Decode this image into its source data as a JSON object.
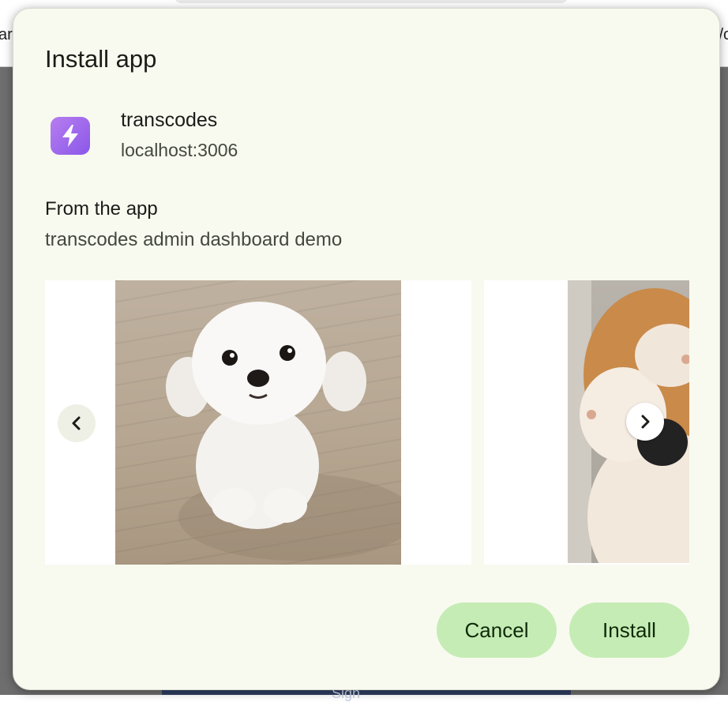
{
  "background": {
    "left_fragment": "ar",
    "right_fragment": "/c",
    "bottom_fragment": "Sign"
  },
  "dialog": {
    "title": "Install app",
    "app": {
      "name": "transcodes",
      "origin": "localhost:3006",
      "icon": "lightning-bolt-icon",
      "icon_color": "#9b6cf0"
    },
    "from_heading": "From the app",
    "description": "transcodes admin dashboard demo",
    "screenshots": [
      {
        "name": "maltese-puppy-screenshot"
      },
      {
        "name": "shiba-covering-face-screenshot"
      }
    ],
    "buttons": {
      "cancel": "Cancel",
      "install": "Install"
    },
    "accent_color": "#c5ecb4"
  }
}
